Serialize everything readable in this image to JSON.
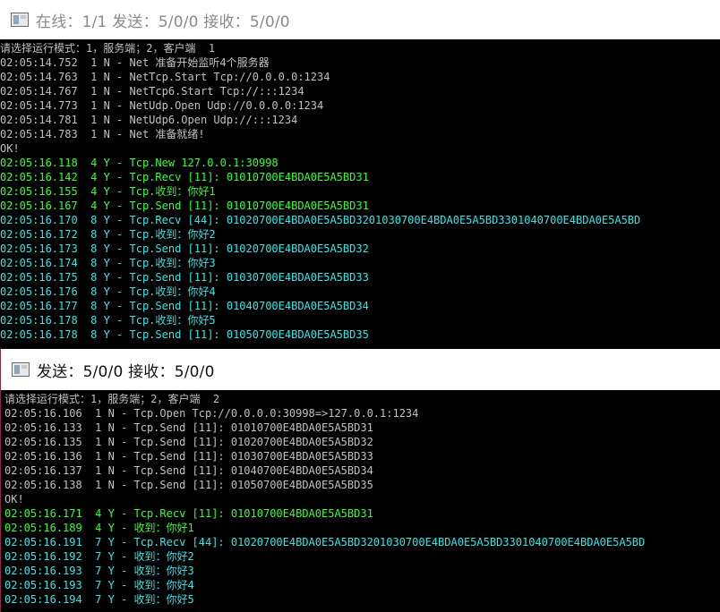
{
  "window1": {
    "title": "在线：1/1 发送：5/0/0 接收：5/0/0",
    "lines": [
      {
        "text": "请选择运行模式：1，服务端；2，客户端  1",
        "color": "gray"
      },
      {
        "text": "02:05:14.752  1 N - Net 准备开始监听4个服务器",
        "color": "gray"
      },
      {
        "text": "02:05:14.763  1 N - NetTcp.Start Tcp://0.0.0.0:1234",
        "color": "gray"
      },
      {
        "text": "02:05:14.767  1 N - NetTcp6.Start Tcp://:::1234",
        "color": "gray"
      },
      {
        "text": "02:05:14.773  1 N - NetUdp.Open Udp://0.0.0.0:1234",
        "color": "gray"
      },
      {
        "text": "02:05:14.781  1 N - NetUdp6.Open Udp://:::1234",
        "color": "gray"
      },
      {
        "text": "02:05:14.783  1 N - Net 准备就绪!",
        "color": "gray"
      },
      {
        "text": "OK!",
        "color": "gray"
      },
      {
        "text": "02:05:16.118  4 Y - Tcp.New 127.0.0.1:30998",
        "color": "green"
      },
      {
        "text": "02:05:16.142  4 Y - Tcp.Recv [11]: 01010700E4BDA0E5A5BD31",
        "color": "green"
      },
      {
        "text": "02:05:16.155  4 Y - Tcp.收到：你好1",
        "color": "green"
      },
      {
        "text": "02:05:16.167  4 Y - Tcp.Send [11]: 01010700E4BDA0E5A5BD31",
        "color": "green"
      },
      {
        "text": "02:05:16.170  8 Y - Tcp.Recv [44]: 01020700E4BDA0E5A5BD3201030700E4BDA0E5A5BD3301040700E4BDA0E5A5BD",
        "color": "cyan"
      },
      {
        "text": "02:05:16.172  8 Y - Tcp.收到：你好2",
        "color": "cyan"
      },
      {
        "text": "02:05:16.173  8 Y - Tcp.Send [11]: 01020700E4BDA0E5A5BD32",
        "color": "cyan"
      },
      {
        "text": "02:05:16.174  8 Y - Tcp.收到：你好3",
        "color": "cyan"
      },
      {
        "text": "02:05:16.175  8 Y - Tcp.Send [11]: 01030700E4BDA0E5A5BD33",
        "color": "cyan"
      },
      {
        "text": "02:05:16.176  8 Y - Tcp.收到：你好4",
        "color": "cyan"
      },
      {
        "text": "02:05:16.177  8 Y - Tcp.Send [11]: 01040700E4BDA0E5A5BD34",
        "color": "cyan"
      },
      {
        "text": "02:05:16.178  8 Y - Tcp.收到：你好5",
        "color": "cyan"
      },
      {
        "text": "02:05:16.178  8 Y - Tcp.Send [11]: 01050700E4BDA0E5A5BD35",
        "color": "cyan"
      }
    ]
  },
  "window2": {
    "title": "发送：5/0/0 接收：5/0/0",
    "lines": [
      {
        "text": "请选择运行模式：1，服务端；2，客户端  2",
        "color": "gray"
      },
      {
        "text": "02:05:16.106  1 N - Tcp.Open Tcp://0.0.0.0:30998=>127.0.0.1:1234",
        "color": "gray"
      },
      {
        "text": "02:05:16.133  1 N - Tcp.Send [11]: 01010700E4BDA0E5A5BD31",
        "color": "gray"
      },
      {
        "text": "02:05:16.135  1 N - Tcp.Send [11]: 01020700E4BDA0E5A5BD32",
        "color": "gray"
      },
      {
        "text": "02:05:16.136  1 N - Tcp.Send [11]: 01030700E4BDA0E5A5BD33",
        "color": "gray"
      },
      {
        "text": "02:05:16.137  1 N - Tcp.Send [11]: 01040700E4BDA0E5A5BD34",
        "color": "gray"
      },
      {
        "text": "02:05:16.138  1 N - Tcp.Send [11]: 01050700E4BDA0E5A5BD35",
        "color": "gray"
      },
      {
        "text": "OK!",
        "color": "gray"
      },
      {
        "text": "02:05:16.171  4 Y - Tcp.Recv [11]: 01010700E4BDA0E5A5BD31",
        "color": "green"
      },
      {
        "text": "02:05:16.189  4 Y - 收到：你好1",
        "color": "green"
      },
      {
        "text": "02:05:16.191  7 Y - Tcp.Recv [44]: 01020700E4BDA0E5A5BD3201030700E4BDA0E5A5BD3301040700E4BDA0E5A5BD",
        "color": "cyan"
      },
      {
        "text": "02:05:16.192  7 Y - 收到：你好2",
        "color": "cyan"
      },
      {
        "text": "02:05:16.193  7 Y - 收到：你好3",
        "color": "cyan"
      },
      {
        "text": "02:05:16.193  7 Y - 收到：你好4",
        "color": "cyan"
      },
      {
        "text": "02:05:16.194  7 Y - 收到：你好5",
        "color": "cyan"
      }
    ]
  },
  "colors": {
    "gray": "#c0c0c0",
    "green": "#33ff33",
    "cyan": "#33e6e6",
    "console_bg": "#000000"
  },
  "icons": {
    "app": "console-window-icon"
  }
}
